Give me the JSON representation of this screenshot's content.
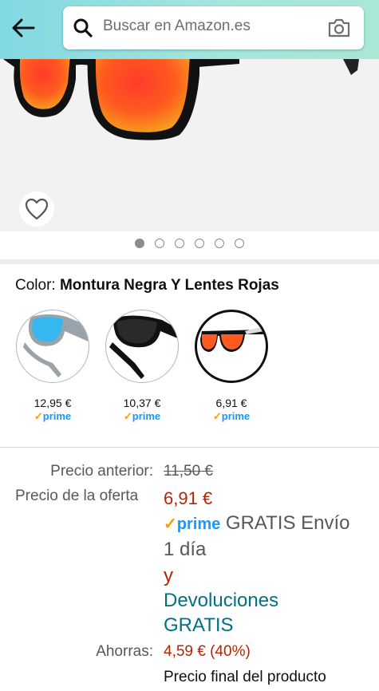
{
  "header": {
    "search_placeholder": "Buscar en Amazon.es"
  },
  "gallery": {
    "page_count": 6,
    "active_index": 0
  },
  "variation": {
    "label": "Color:",
    "selected": "Montura Negra Y Lentes Rojas",
    "swatches": [
      {
        "price": "12,95 €",
        "prime": "prime",
        "lens_color": "#35b8f0",
        "frame_color": "#9aa3aa"
      },
      {
        "price": "10,37 €",
        "prime": "prime",
        "lens_color": "#222222",
        "frame_color": "#111111"
      },
      {
        "price": "6,91 €",
        "prime": "prime",
        "lens_color": "#ff5a1f",
        "frame_color": "#111111"
      }
    ]
  },
  "pricing": {
    "previous_label": "Precio anterior:",
    "previous_price": "11,50 €",
    "deal_label": "Precio de la oferta",
    "deal_price": "6,91 €",
    "prime_word": "prime",
    "shipping_line1": "GRATIS Envío",
    "shipping_line2": "1 día",
    "connector": "y",
    "returns_line1": "Devoluciones",
    "returns_line2": "GRATIS",
    "savings_label": "Ahorras:",
    "savings_value": "4,59 € (40%)",
    "final_price_note": "Precio final del producto"
  },
  "colors": {
    "header_start": "#82d8e3",
    "header_end": "#a9e7d6",
    "price_red": "#b12704",
    "link_teal": "#007185",
    "prime_blue": "#1a98ff",
    "prime_check": "#ff9900"
  }
}
